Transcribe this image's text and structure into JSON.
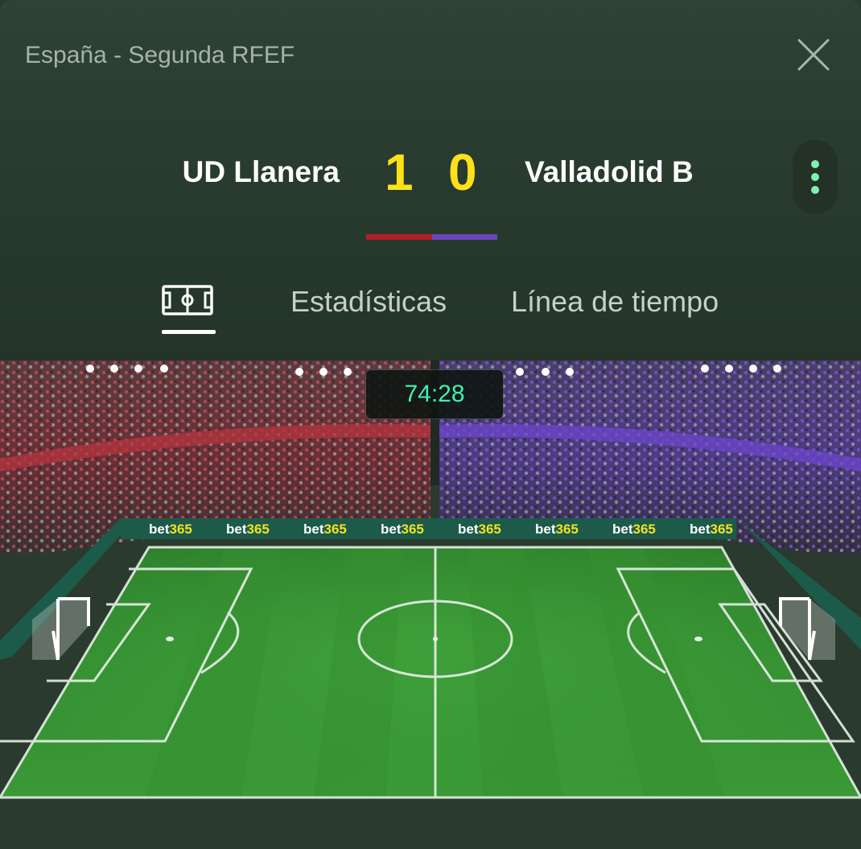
{
  "header": {
    "competition": "España - Segunda RFEF",
    "home_team": "UD Llanera",
    "away_team": "Valladolid B",
    "home_score": "1",
    "away_score": "0",
    "home_color": "#b01e2a",
    "away_color": "#6a45b8"
  },
  "icons": {
    "close": "close-icon",
    "menu": "more-vertical-icon",
    "pitch_tab": "pitch-icon"
  },
  "tabs": [
    {
      "label": "",
      "icon": "pitch-icon",
      "active": true
    },
    {
      "label": "Estadísticas",
      "active": false
    },
    {
      "label": "Línea de tiempo",
      "active": false
    }
  ],
  "match": {
    "clock": "74:28",
    "sponsor": "bet365"
  },
  "colors": {
    "clock_text": "#3ff0b3",
    "score_text": "#ffe11a",
    "pitch_green": "#2f8a2c",
    "sponsor_yellow": "#f4e21c"
  }
}
